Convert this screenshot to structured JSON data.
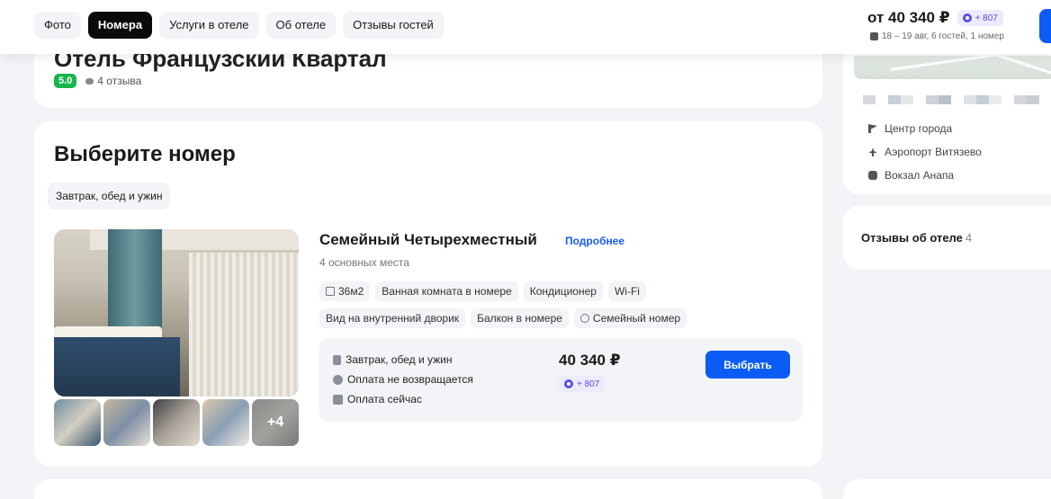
{
  "header": {
    "tabs": [
      {
        "label": "Фото"
      },
      {
        "label": "Номера",
        "active": true
      },
      {
        "label": "Услуги в отеле"
      },
      {
        "label": "Об отеле"
      },
      {
        "label": "Отзывы гостей"
      }
    ],
    "price_from": "от 40 340 ₽",
    "bonus": "+ 807",
    "dates_guests": "18 – 19 авг, 6 гостей, 1 номер"
  },
  "hotel": {
    "title": "Отель Французский Квартал",
    "score": "5.0",
    "reviews_count": "4 отзыва"
  },
  "rooms": {
    "title": "Выберите номер",
    "filter_chip": "Завтрак, обед и ужин",
    "room": {
      "name": "Семейный Четырехместный",
      "details_link": "Подробнее",
      "subtitle": "4 основных места",
      "amenities_row1": [
        "36м2",
        "Ванная комната в номере",
        "Кондиционер",
        "Wi-Fi"
      ],
      "amenities_row2": [
        "Вид на внутренний дворик",
        "Балкон в номере",
        "Семейный номер"
      ],
      "more_photos": "+4",
      "offer": {
        "meals": "Завтрак, обед и ужин",
        "refund": "Оплата не возвращается",
        "payment": "Оплата сейчас",
        "price": "40 340 ₽",
        "bonus": "+ 807",
        "select_label": "Выбрать"
      }
    }
  },
  "sidebar": {
    "locations": [
      "Центр города",
      "Аэропорт Витязево",
      "Вокзал Анапа"
    ],
    "reviews_title": "Отзывы об отеле",
    "reviews_count": "4"
  },
  "colors": {
    "accent_blue": "#0a5cf5",
    "score_green": "#19b44c",
    "bonus_purple": "#5b4ee6"
  }
}
